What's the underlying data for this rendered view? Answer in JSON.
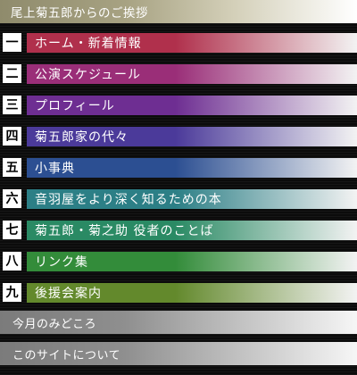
{
  "header": {
    "title": "尾上菊五郎からのご挨拶"
  },
  "nav": {
    "items": [
      {
        "num": "一",
        "label": "ホーム・新着情報",
        "color": "#b0304c"
      },
      {
        "num": "二",
        "label": "公演スケジュール",
        "color": "#9a2e78"
      },
      {
        "num": "三",
        "label": "プロフィール",
        "color": "#6e2e92"
      },
      {
        "num": "四",
        "label": "菊五郎家の代々",
        "color": "#4b3a9a"
      },
      {
        "num": "五",
        "label": "小事典",
        "color": "#2c4f92"
      },
      {
        "num": "六",
        "label": "音羽屋をより深く知るための本",
        "color": "#2c7f86"
      },
      {
        "num": "七",
        "label": "菊五郎・菊之助 役者のことば",
        "color": "#2a8a64"
      },
      {
        "num": "八",
        "label": "リンク集",
        "color": "#338c3a"
      },
      {
        "num": "九",
        "label": "後援会案内",
        "color": "#63892c"
      }
    ]
  },
  "sub": {
    "items": [
      {
        "label": "今月のみどころ"
      },
      {
        "label": "このサイトについて"
      }
    ]
  }
}
